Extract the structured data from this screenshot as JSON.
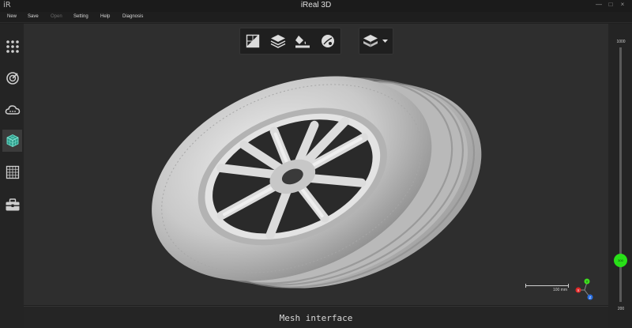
{
  "app": {
    "logo": "iR",
    "title": "iReal 3D"
  },
  "window_controls": [
    "—",
    "□",
    "×"
  ],
  "menu": [
    {
      "label": "New",
      "enabled": true
    },
    {
      "label": "Save",
      "enabled": true
    },
    {
      "label": "Open",
      "enabled": false
    },
    {
      "label": "Setting",
      "enabled": true
    },
    {
      "label": "Help",
      "enabled": true
    },
    {
      "label": "Diagnosis",
      "enabled": true
    }
  ],
  "sidebar": [
    {
      "name": "point-grid-icon",
      "active": false
    },
    {
      "name": "scan-target-icon",
      "active": false
    },
    {
      "name": "cloud-icon",
      "active": false
    },
    {
      "name": "mesh-cube-icon",
      "active": true
    },
    {
      "name": "grid-table-icon",
      "active": false
    },
    {
      "name": "toolbox-icon",
      "active": false
    }
  ],
  "toolbar": [
    {
      "name": "triangle-mesh-icon"
    },
    {
      "name": "layers-icon"
    },
    {
      "name": "fill-paint-icon"
    },
    {
      "name": "texture-sphere-icon"
    }
  ],
  "view_menu": {
    "name": "stack-view-icon"
  },
  "scale": {
    "label": "100 mm"
  },
  "axes": {
    "y": "Y",
    "x": "X",
    "z": "Z"
  },
  "status": {
    "text": "Mesh interface"
  },
  "distance_slider": {
    "max_label": "1000",
    "min_label": "200",
    "knob_label": "300",
    "value": 300,
    "min": 200,
    "max": 1000
  },
  "colors": {
    "accent_green": "#28e018",
    "active_icon": "#46c8b0",
    "background": "#2e2e2e"
  }
}
